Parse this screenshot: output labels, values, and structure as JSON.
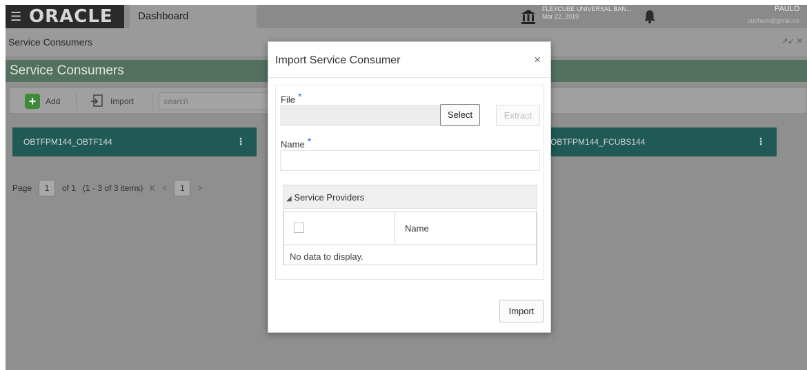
{
  "header": {
    "logo": "ORACLE",
    "tab_label": "Dashboard",
    "bank_name": "FLEXCUBE UNIVERSAL BAN...",
    "bank_date": "Mar 22, 2019",
    "user_name": "PAULO",
    "user_email": "subham@gmail.co"
  },
  "breadcrumb": "Service Consumers",
  "page": {
    "title": "Service Consumers",
    "toolbar": {
      "add_label": "Add",
      "import_label": "Import",
      "search_placeholder": "search"
    },
    "cards": [
      {
        "label": "OBTFPM144_OBTF144"
      },
      {
        "label": "OBTFPM144_FCUBS144"
      }
    ],
    "pager": {
      "page_label": "Page",
      "current_page": "1",
      "of_label": "of 1",
      "range_label": "(1 - 3 of 3 items)",
      "first_symbol": "K",
      "prev_symbol": "<",
      "page_box": "1",
      "next_symbol": ">"
    }
  },
  "modal": {
    "title": "Import Service Consumer",
    "close_symbol": "×",
    "file_label": "File",
    "required_mark": "*",
    "select_button": "Select",
    "extract_button": "Extract",
    "name_label": "Name",
    "service_providers": {
      "heading": "Service Providers",
      "column_name": "Name",
      "empty_message": "No data to display."
    },
    "import_button": "Import"
  },
  "colors": {
    "header_dark": "#2a2a2a",
    "title_green": "#52725f",
    "card_teal": "#1f5a55",
    "required_blue": "#2a6ad6"
  }
}
